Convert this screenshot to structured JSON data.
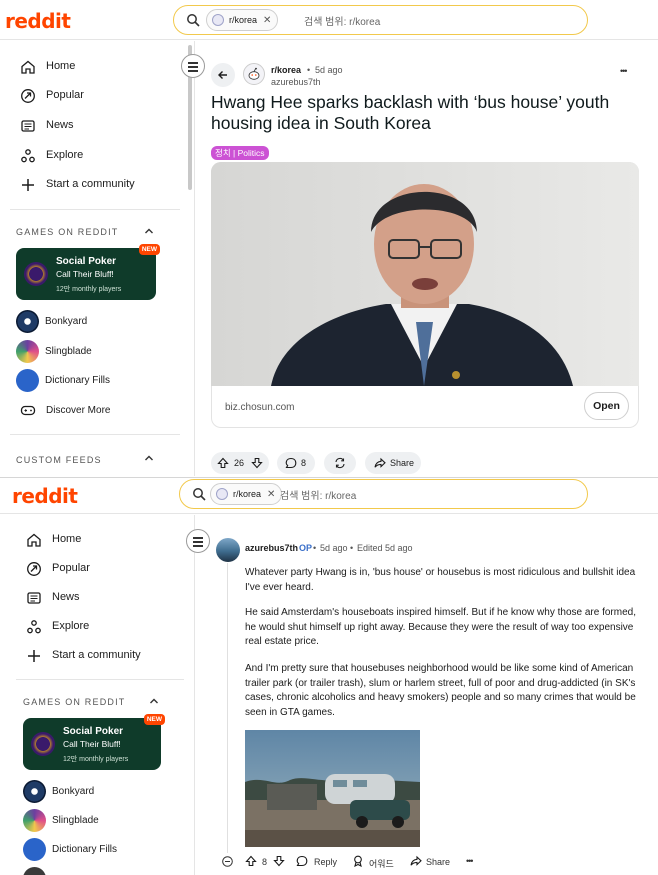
{
  "brand": {
    "name": "reddit",
    "color": "#ff4500"
  },
  "search": {
    "community_chip": "r/korea",
    "placeholder": "검색 범위: r/korea"
  },
  "sidebar": {
    "items": [
      {
        "label": "Home",
        "icon": "home-icon"
      },
      {
        "label": "Popular",
        "icon": "popular-icon"
      },
      {
        "label": "News",
        "icon": "news-icon"
      },
      {
        "label": "Explore",
        "icon": "explore-icon"
      },
      {
        "label": "Start a community",
        "icon": "plus-icon"
      }
    ],
    "games_title": "GAMES ON REDDIT",
    "featured_game": {
      "title": "Social Poker",
      "subtitle": "Call Their Bluff!",
      "players": "12만 monthly players",
      "badge": "NEW"
    },
    "games": [
      {
        "label": "Bonkyard"
      },
      {
        "label": "Slingblade"
      },
      {
        "label": "Dictionary Fills"
      }
    ],
    "discover_more": "Discover More",
    "custom_feeds_title": "CUSTOM FEEDS"
  },
  "post": {
    "subreddit": "r/korea",
    "time": "5d ago",
    "separator": "•",
    "author": "azurebus7th",
    "title": "Hwang Hee sparks backlash with ‘bus house’ youth housing idea in South Korea",
    "flair": "정치 | Politics",
    "link_domain": "biz.chosun.com",
    "open_label": "Open",
    "votes": "26",
    "comments": "8",
    "share_label": "Share",
    "more_label": "•••"
  },
  "comment": {
    "author": "azurebus7th",
    "op_badge": "OP",
    "time": "5d ago",
    "edited": "Edited 5d ago",
    "paragraphs": [
      "Whatever party Hwang is in, 'bus house' or housebus is most ridiculous and bullshit idea I've ever heard.",
      "He said Amsterdam's houseboats inspired himself. But if he know why those are formed, he would shut himself up right away. Because they were the result of way too expensive real estate price.",
      "And I'm pretty sure that housebuses neighborhood would be like some kind of American trailer park (or trailer trash), slum or harlem street, full of poor and drug-addicted (in SK's cases, chronic alcoholics and heavy smokers) people and so many crimes that would be seen in GTA games."
    ],
    "votes": "8",
    "reply_label": "Reply",
    "award_label": "어워드",
    "share_label": "Share",
    "more_label": "•••"
  }
}
